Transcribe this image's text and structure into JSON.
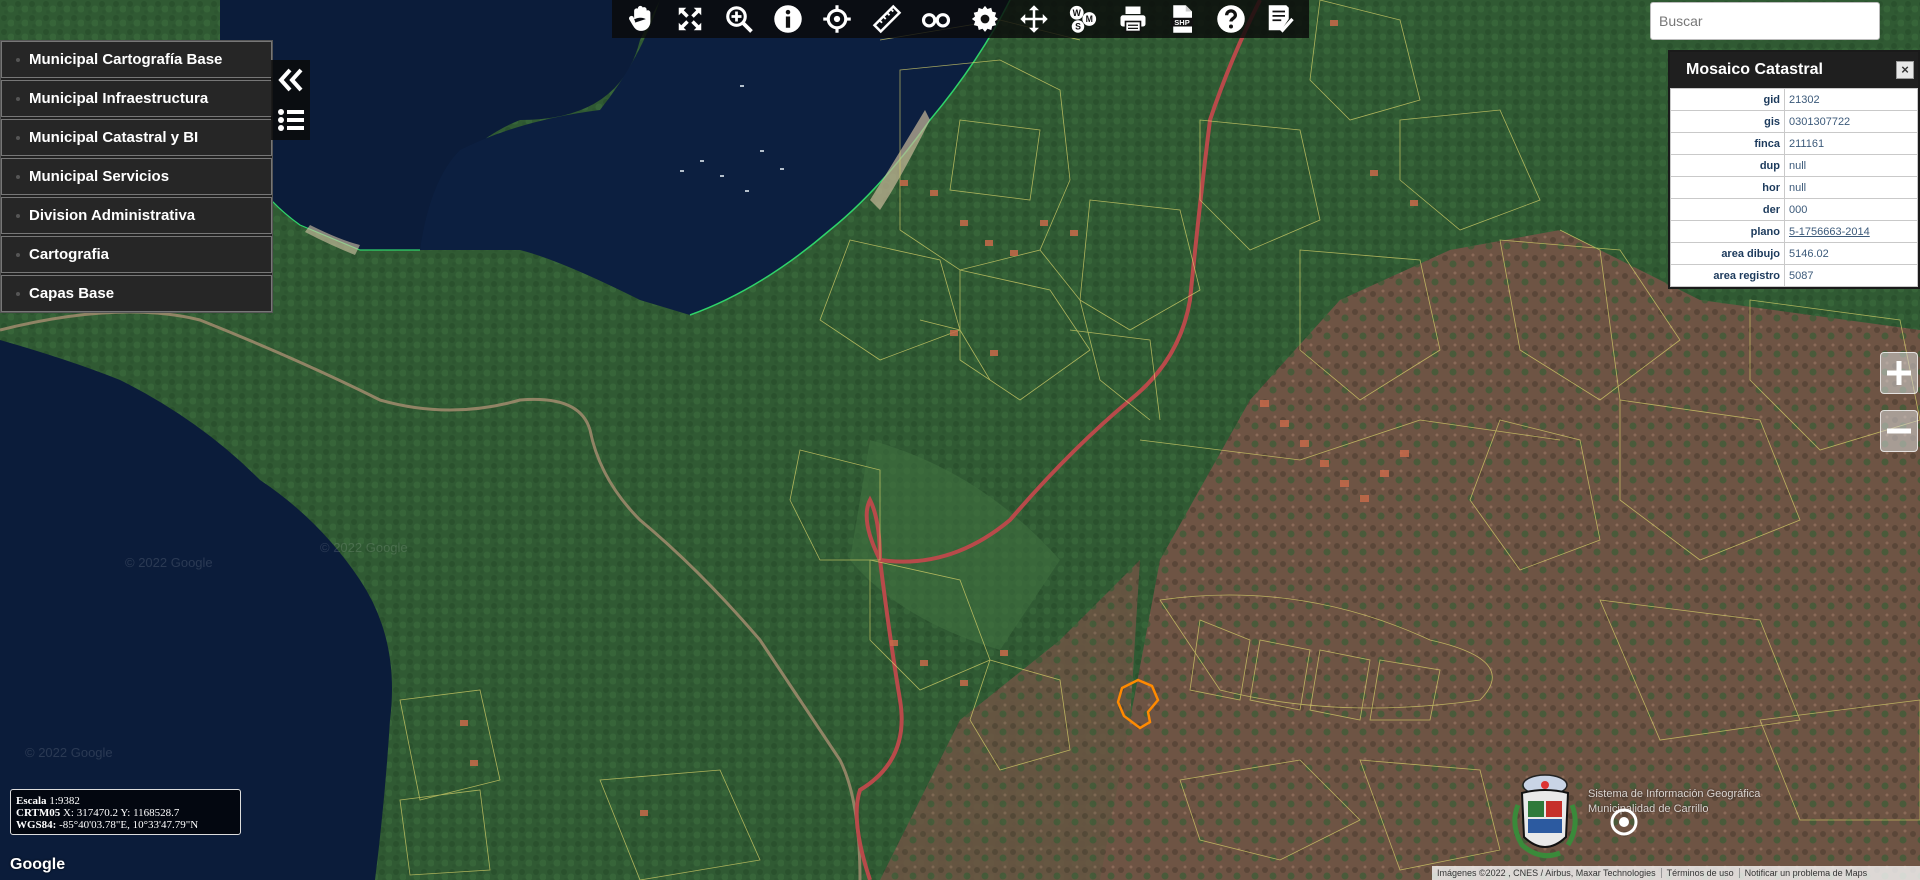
{
  "toolbar": {
    "tools": [
      {
        "name": "pan-tool",
        "icon": "hand-icon"
      },
      {
        "name": "full-extent-tool",
        "icon": "expand-icon"
      },
      {
        "name": "zoom-in-tool",
        "icon": "magnifier-plus-icon"
      },
      {
        "name": "identify-tool",
        "icon": "info-icon"
      },
      {
        "name": "locate-tool",
        "icon": "crosshair-icon"
      },
      {
        "name": "measure-tool",
        "icon": "ruler-icon"
      },
      {
        "name": "streetview-tool",
        "icon": "binoculars-icon"
      },
      {
        "name": "settings-tool",
        "icon": "gear-icon"
      },
      {
        "name": "move-tool",
        "icon": "move-arrows-icon"
      },
      {
        "name": "wms-tool",
        "icon": "wms-icon"
      },
      {
        "name": "print-tool",
        "icon": "printer-icon"
      },
      {
        "name": "shp-tool",
        "icon": "shp-file-icon"
      },
      {
        "name": "help-tool",
        "icon": "help-icon"
      },
      {
        "name": "report-tool",
        "icon": "checklist-icon"
      }
    ],
    "wms_letters": "WMS",
    "shp_label": "SHP"
  },
  "layer_menu": {
    "items": [
      "Municipal Cartografía Base",
      "Municipal Infraestructura",
      "Municipal Catastral y BI",
      "Municipal Servicios",
      "Division Administrativa",
      "Cartografia",
      "Capas Base"
    ]
  },
  "search": {
    "placeholder": "Buscar"
  },
  "info_panel": {
    "title": "Mosaico Catastral",
    "close": "×",
    "rows": [
      {
        "key": "gid",
        "value": "21302"
      },
      {
        "key": "gis",
        "value": "0301307722"
      },
      {
        "key": "finca",
        "value": "211161"
      },
      {
        "key": "dup",
        "value": "null"
      },
      {
        "key": "hor",
        "value": "null"
      },
      {
        "key": "der",
        "value": "000"
      },
      {
        "key": "plano",
        "value": "5-1756663-2014",
        "link": true
      },
      {
        "key": "area dibujo",
        "value": "5146.02"
      },
      {
        "key": "area registro",
        "value": "5087"
      }
    ]
  },
  "scale": {
    "escala_label": "Escala",
    "escala_value": "1:9382",
    "crtm_label": "CRTM05",
    "crtm_value": "X: 317470.2 Y: 1168528.7",
    "wgs_label": "WGS84:",
    "wgs_value": "-85°40'03.78\"E, 10°33'47.79\"N"
  },
  "google_logo": "Google",
  "watermarks": [
    "© 2022 Google",
    "© 2022 Google",
    "© 2022 Google"
  ],
  "attribution": {
    "imagery": "Imágenes ©2022 , CNES / Airbus, Maxar Technologies",
    "terms": "Términos de uso",
    "report": "Notificar un problema de Maps"
  },
  "logo_text": {
    "line1": "Sistema de Información Geográfica",
    "line2": "Municipalidad de Carrillo"
  },
  "colors": {
    "parcel_line": "#d8d26a",
    "road": "#b84a4a",
    "highlight": "#ff8a00",
    "coast": "#2fd36a",
    "water": "#0b1c3a",
    "forest": "#2f5a32",
    "dry": "#6b4e3e"
  }
}
